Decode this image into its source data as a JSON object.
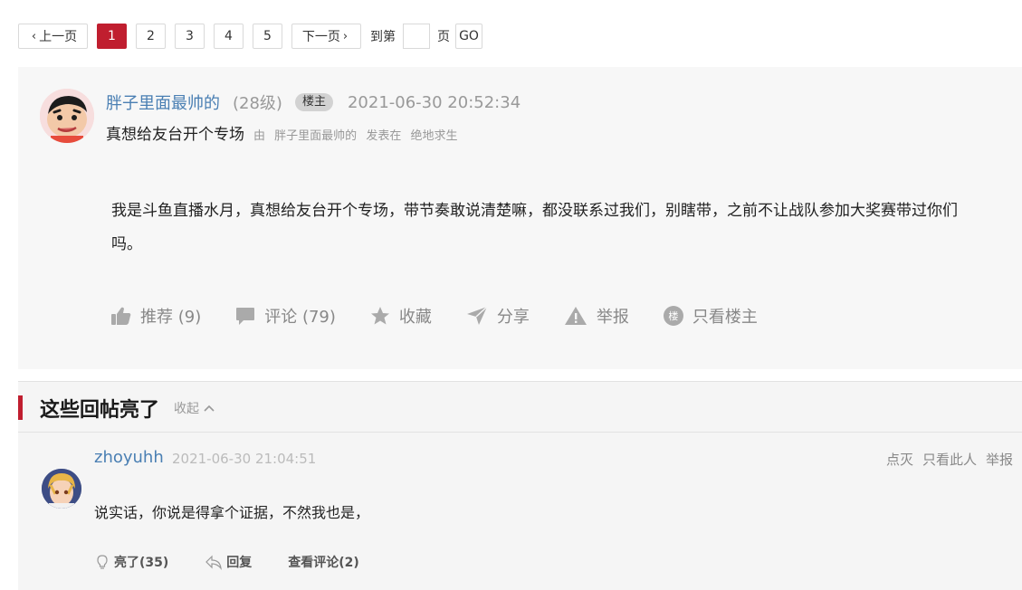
{
  "pagination": {
    "prev_label": "上一页",
    "pages": [
      "1",
      "2",
      "3",
      "4",
      "5"
    ],
    "current_page": "1",
    "next_label": "下一页",
    "goto_prefix": "到第",
    "goto_suffix": "页",
    "go_label": "GO"
  },
  "post": {
    "author": "胖子里面最帅的",
    "level": "(28级)",
    "owner_badge": "楼主",
    "time": "2021-06-30 20:52:34",
    "title": "真想给友台开个专场",
    "meta_by": "由",
    "meta_author": "胖子里面最帅的",
    "meta_posted_in": "发表在",
    "meta_board": "绝地求生",
    "body": "我是斗鱼直播水月，真想给友台开个专场，带节奏敢说清楚嘛，都没联系过我们，别瞎带，之前不让战队参加大奖赛带过你们吗。",
    "actions": {
      "recommend": "推荐 (9)",
      "comment": "评论 (79)",
      "favorite": "收藏",
      "share": "分享",
      "report": "举报",
      "owner_only": "只看楼主"
    },
    "owner_icon_char": "楼"
  },
  "hot_replies": {
    "title": "这些回帖亮了",
    "collapse_label": "收起",
    "items": [
      {
        "user": "zhoyuhh",
        "time": "2021-06-30 21:04:51",
        "links": {
          "dislike": "点灭",
          "only_this": "只看此人",
          "report": "举报"
        },
        "body": "说实话，你说是得拿个证据，不然我也是，",
        "light": "亮了(35)",
        "reply": "回复",
        "view_comments": "查看评论(2)"
      }
    ]
  },
  "colors": {
    "accent": "#c01e2f",
    "link": "#4a7fb3",
    "muted": "#999999"
  }
}
